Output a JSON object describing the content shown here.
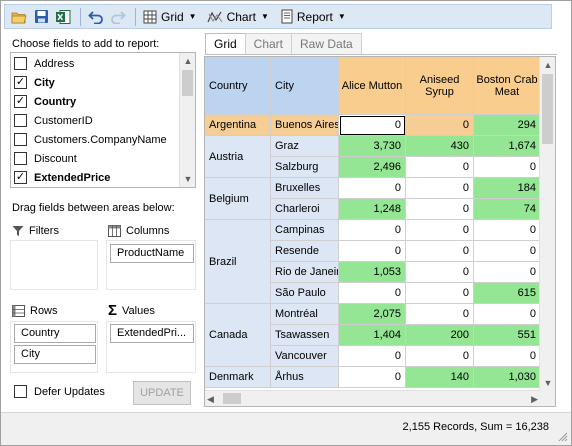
{
  "toolbar": {
    "grid_label": "Grid",
    "chart_label": "Chart",
    "report_label": "Report"
  },
  "fields_panel": {
    "title": "Choose fields to add to report:",
    "items": [
      {
        "label": "Address",
        "checked": false
      },
      {
        "label": "City",
        "checked": true
      },
      {
        "label": "Country",
        "checked": true
      },
      {
        "label": "CustomerID",
        "checked": false
      },
      {
        "label": "Customers.CompanyName",
        "checked": false
      },
      {
        "label": "Discount",
        "checked": false
      },
      {
        "label": "ExtendedPrice",
        "checked": true
      }
    ],
    "drag_label": "Drag fields between areas below:"
  },
  "areas": {
    "filters_label": "Filters",
    "columns_label": "Columns",
    "rows_label": "Rows",
    "values_label": "Values",
    "columns_fields": [
      "ProductName"
    ],
    "rows_fields": [
      "Country",
      "City"
    ],
    "values_fields": [
      "ExtendedPri..."
    ]
  },
  "defer_updates": {
    "label": "Defer Updates",
    "checked": false
  },
  "update_button": "UPDATE",
  "tabs": [
    {
      "label": "Grid",
      "active": true
    },
    {
      "label": "Chart",
      "active": false
    },
    {
      "label": "Raw Data",
      "active": false
    }
  ],
  "grid": {
    "row_headers": [
      "Country",
      "City"
    ],
    "column_headers": [
      "Alice Mutton",
      "Aniseed Syrup",
      "Boston Crab Meat"
    ],
    "countries": [
      {
        "name": "Argentina",
        "rows": 1
      },
      {
        "name": "Austria",
        "rows": 2
      },
      {
        "name": "Belgium",
        "rows": 2
      },
      {
        "name": "Brazil",
        "rows": 4
      },
      {
        "name": "Canada",
        "rows": 3
      },
      {
        "name": "Denmark",
        "rows": 1
      }
    ],
    "rows": [
      {
        "city": "Buenos Aires",
        "values": [
          "0",
          "0",
          "294"
        ]
      },
      {
        "city": "Graz",
        "values": [
          "3,730",
          "430",
          "1,674"
        ]
      },
      {
        "city": "Salzburg",
        "values": [
          "2,496",
          "0",
          "0"
        ]
      },
      {
        "city": "Bruxelles",
        "values": [
          "0",
          "0",
          "184"
        ]
      },
      {
        "city": "Charleroi",
        "values": [
          "1,248",
          "0",
          "74"
        ]
      },
      {
        "city": "Campinas",
        "values": [
          "0",
          "0",
          "0"
        ]
      },
      {
        "city": "Resende",
        "values": [
          "0",
          "0",
          "0"
        ]
      },
      {
        "city": "Rio de Janeiro",
        "values": [
          "1,053",
          "0",
          "0"
        ]
      },
      {
        "city": "São Paulo",
        "values": [
          "0",
          "0",
          "615"
        ]
      },
      {
        "city": "Montréal",
        "values": [
          "2,075",
          "0",
          "0"
        ]
      },
      {
        "city": "Tsawassen",
        "values": [
          "1,404",
          "200",
          "551"
        ]
      },
      {
        "city": "Vancouver",
        "values": [
          "0",
          "0",
          "0"
        ]
      },
      {
        "city": "Århus",
        "values": [
          "0",
          "140",
          "1,030"
        ]
      }
    ]
  },
  "status": "2,155 Records, Sum = 16,238",
  "colors": {
    "toolbar_bg": "#dde8f5",
    "row_header_bg": "#bdd4f1",
    "column_header_bg": "#f8cd8e",
    "highlight_green": "#94e695",
    "selected_row_bg": "#f5cd95"
  }
}
